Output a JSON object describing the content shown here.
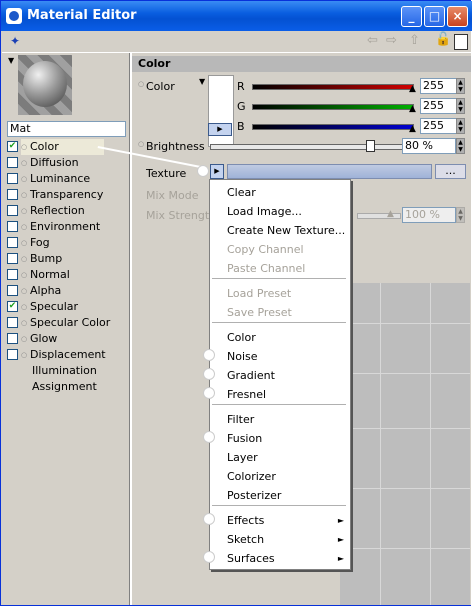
{
  "window": {
    "title": "Material Editor",
    "minimize": "_",
    "maximize": "□",
    "close": "×"
  },
  "toolbar": {
    "lock_icon": "lock-icon"
  },
  "preview": {
    "material_name": "Mat"
  },
  "channels": [
    {
      "label": "Color",
      "checked": true,
      "active": true
    },
    {
      "label": "Diffusion",
      "checked": false
    },
    {
      "label": "Luminance",
      "checked": false
    },
    {
      "label": "Transparency",
      "checked": false
    },
    {
      "label": "Reflection",
      "checked": false
    },
    {
      "label": "Environment",
      "checked": false
    },
    {
      "label": "Fog",
      "checked": false
    },
    {
      "label": "Bump",
      "checked": false
    },
    {
      "label": "Normal",
      "checked": false
    },
    {
      "label": "Alpha",
      "checked": false
    },
    {
      "label": "Specular",
      "checked": true
    },
    {
      "label": "Specular Color",
      "checked": false
    },
    {
      "label": "Glow",
      "checked": false
    },
    {
      "label": "Displacement",
      "checked": false
    },
    {
      "label": "Illumination",
      "plain": true
    },
    {
      "label": "Assignment",
      "plain": true
    }
  ],
  "color_panel": {
    "header": "Color",
    "color_label": "Color",
    "r_label": "R",
    "g_label": "G",
    "b_label": "B",
    "r_value": "255",
    "g_value": "255",
    "b_value": "255",
    "brightness_label": "Brightness",
    "brightness_value": "80 %",
    "brightness_level": 0.8,
    "texture_label": "Texture",
    "texture_more": "...",
    "mix_mode_label": "Mix Mode",
    "mix_strength_label": "Mix Strength",
    "mix_strength_value": "100 %",
    "colors": {
      "r": "#d00000",
      "g": "#00b000",
      "b": "#0000d0"
    }
  },
  "menu": {
    "items": [
      {
        "label": "Clear"
      },
      {
        "label": "Load Image..."
      },
      {
        "label": "Create New Texture..."
      },
      {
        "label": "Copy Channel",
        "disabled": true
      },
      {
        "label": "Paste Channel",
        "disabled": true
      },
      {
        "label": "Load Preset",
        "disabled": true
      },
      {
        "label": "Save Preset",
        "disabled": true
      },
      {
        "label": "Color"
      },
      {
        "label": "Noise"
      },
      {
        "label": "Gradient"
      },
      {
        "label": "Fresnel"
      },
      {
        "label": "Filter"
      },
      {
        "label": "Fusion"
      },
      {
        "label": "Layer"
      },
      {
        "label": "Colorizer"
      },
      {
        "label": "Posterizer"
      },
      {
        "label": "Effects",
        "submenu": true
      },
      {
        "label": "Sketch",
        "submenu": true
      },
      {
        "label": "Surfaces",
        "submenu": true
      }
    ],
    "submenu_glyph": "►"
  }
}
